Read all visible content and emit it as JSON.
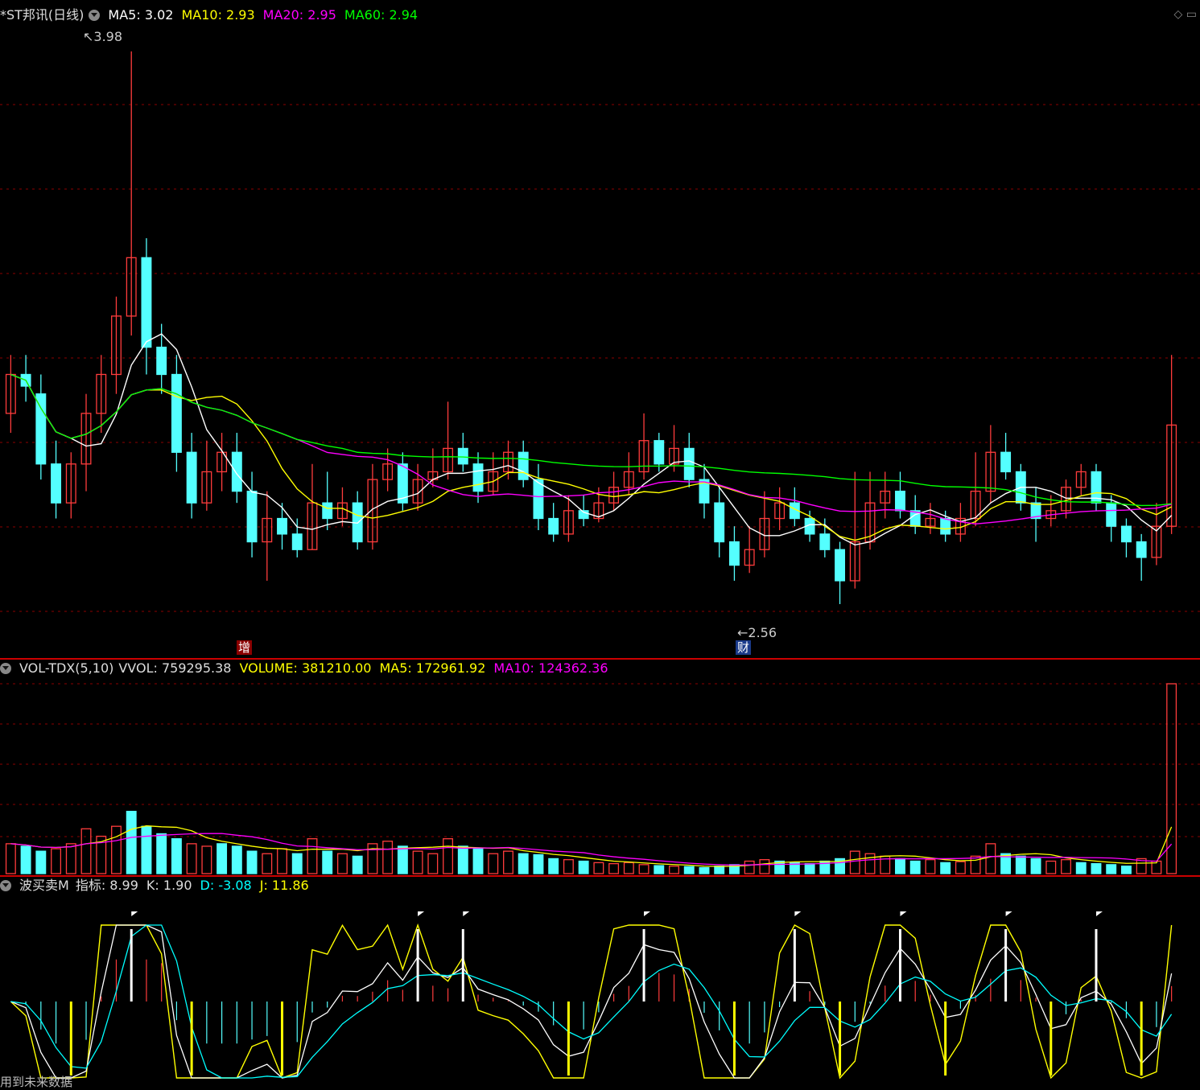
{
  "main": {
    "title": "*ST邦讯(日线)",
    "ma": [
      {
        "label": "MA5: 3.02",
        "color": "#ffffff"
      },
      {
        "label": "MA10: 2.93",
        "color": "#ffff00"
      },
      {
        "label": "MA20: 2.95",
        "color": "#ff00ff"
      },
      {
        "label": "MA60: 2.94",
        "color": "#00ff00"
      }
    ],
    "high_label": "3.98",
    "low_label": "2.56",
    "tag_zeng": "增",
    "tag_cai": "财"
  },
  "volume": {
    "name": "VOL-TDX(5,10)",
    "fields": [
      {
        "label": "VVOL: 759295.38",
        "color": "#dddddd"
      },
      {
        "label": "VOLUME: 381210.00",
        "color": "#ffff00"
      },
      {
        "label": "MA5: 172961.92",
        "color": "#ffff00"
      },
      {
        "label": "MA10: 124362.36",
        "color": "#ff00ff"
      }
    ]
  },
  "indicator": {
    "name": "波买卖M",
    "fields": [
      {
        "label": "指标: 8.99",
        "color": "#dddddd"
      },
      {
        "label": "K: 1.90",
        "color": "#dddddd"
      },
      {
        "label": "D: -3.08",
        "color": "#00ffff"
      },
      {
        "label": "J: 11.86",
        "color": "#ffff00"
      }
    ],
    "footer": "用到未来数据"
  },
  "colors": {
    "up": "#ff3c3c",
    "down": "#54ffff",
    "grid": "#8b0000",
    "ma5": "#ffffff",
    "ma10": "#ffff00",
    "ma20": "#ff00ff",
    "ma60": "#00ff00"
  },
  "chart_data": {
    "type": "candlestick",
    "price_range": [
      2.56,
      3.98
    ],
    "candles": [
      {
        "o": 3.05,
        "c": 3.15,
        "h": 3.2,
        "l": 3.0
      },
      {
        "o": 3.15,
        "c": 3.12,
        "h": 3.2,
        "l": 3.08
      },
      {
        "o": 3.1,
        "c": 2.92,
        "h": 3.15,
        "l": 2.88
      },
      {
        "o": 2.92,
        "c": 2.82,
        "h": 2.98,
        "l": 2.78
      },
      {
        "o": 2.82,
        "c": 2.92,
        "h": 2.95,
        "l": 2.78
      },
      {
        "o": 2.92,
        "c": 3.05,
        "h": 3.1,
        "l": 2.85
      },
      {
        "o": 3.05,
        "c": 3.15,
        "h": 3.2,
        "l": 3.0
      },
      {
        "o": 3.15,
        "c": 3.3,
        "h": 3.35,
        "l": 3.1
      },
      {
        "o": 3.3,
        "c": 3.45,
        "h": 3.98,
        "l": 3.25
      },
      {
        "o": 3.45,
        "c": 3.22,
        "h": 3.5,
        "l": 3.15
      },
      {
        "o": 3.22,
        "c": 3.15,
        "h": 3.28,
        "l": 3.1
      },
      {
        "o": 3.15,
        "c": 2.95,
        "h": 3.2,
        "l": 2.9
      },
      {
        "o": 2.95,
        "c": 2.82,
        "h": 3.0,
        "l": 2.78
      },
      {
        "o": 2.82,
        "c": 2.9,
        "h": 2.98,
        "l": 2.8
      },
      {
        "o": 2.9,
        "c": 2.95,
        "h": 3.0,
        "l": 2.85
      },
      {
        "o": 2.95,
        "c": 2.85,
        "h": 3.0,
        "l": 2.82
      },
      {
        "o": 2.85,
        "c": 2.72,
        "h": 2.9,
        "l": 2.68
      },
      {
        "o": 2.72,
        "c": 2.78,
        "h": 2.85,
        "l": 2.62
      },
      {
        "o": 2.78,
        "c": 2.74,
        "h": 2.82,
        "l": 2.7
      },
      {
        "o": 2.74,
        "c": 2.7,
        "h": 2.78,
        "l": 2.68
      },
      {
        "o": 2.7,
        "c": 2.82,
        "h": 2.92,
        "l": 2.7
      },
      {
        "o": 2.82,
        "c": 2.78,
        "h": 2.9,
        "l": 2.75
      },
      {
        "o": 2.78,
        "c": 2.82,
        "h": 2.86,
        "l": 2.76
      },
      {
        "o": 2.82,
        "c": 2.72,
        "h": 2.85,
        "l": 2.7
      },
      {
        "o": 2.72,
        "c": 2.88,
        "h": 2.92,
        "l": 2.7
      },
      {
        "o": 2.88,
        "c": 2.92,
        "h": 2.96,
        "l": 2.85
      },
      {
        "o": 2.92,
        "c": 2.82,
        "h": 2.95,
        "l": 2.8
      },
      {
        "o": 2.82,
        "c": 2.88,
        "h": 2.92,
        "l": 2.8
      },
      {
        "o": 2.88,
        "c": 2.9,
        "h": 2.96,
        "l": 2.86
      },
      {
        "o": 2.9,
        "c": 2.96,
        "h": 3.08,
        "l": 2.88
      },
      {
        "o": 2.96,
        "c": 2.92,
        "h": 3.0,
        "l": 2.9
      },
      {
        "o": 2.92,
        "c": 2.85,
        "h": 2.95,
        "l": 2.82
      },
      {
        "o": 2.85,
        "c": 2.9,
        "h": 2.95,
        "l": 2.84
      },
      {
        "o": 2.9,
        "c": 2.95,
        "h": 2.98,
        "l": 2.88
      },
      {
        "o": 2.95,
        "c": 2.88,
        "h": 2.98,
        "l": 2.86
      },
      {
        "o": 2.88,
        "c": 2.78,
        "h": 2.92,
        "l": 2.75
      },
      {
        "o": 2.78,
        "c": 2.74,
        "h": 2.82,
        "l": 2.72
      },
      {
        "o": 2.74,
        "c": 2.8,
        "h": 2.84,
        "l": 2.72
      },
      {
        "o": 2.8,
        "c": 2.78,
        "h": 2.84,
        "l": 2.76
      },
      {
        "o": 2.78,
        "c": 2.82,
        "h": 2.86,
        "l": 2.77
      },
      {
        "o": 2.82,
        "c": 2.86,
        "h": 2.9,
        "l": 2.8
      },
      {
        "o": 2.86,
        "c": 2.9,
        "h": 2.95,
        "l": 2.84
      },
      {
        "o": 2.9,
        "c": 2.98,
        "h": 3.05,
        "l": 2.88
      },
      {
        "o": 2.98,
        "c": 2.92,
        "h": 3.0,
        "l": 2.9
      },
      {
        "o": 2.92,
        "c": 2.96,
        "h": 3.02,
        "l": 2.9
      },
      {
        "o": 2.96,
        "c": 2.88,
        "h": 3.0,
        "l": 2.86
      },
      {
        "o": 2.88,
        "c": 2.82,
        "h": 2.92,
        "l": 2.78
      },
      {
        "o": 2.82,
        "c": 2.72,
        "h": 2.86,
        "l": 2.68
      },
      {
        "o": 2.72,
        "c": 2.66,
        "h": 2.76,
        "l": 2.62
      },
      {
        "o": 2.66,
        "c": 2.7,
        "h": 2.76,
        "l": 2.64
      },
      {
        "o": 2.7,
        "c": 2.78,
        "h": 2.85,
        "l": 2.68
      },
      {
        "o": 2.78,
        "c": 2.82,
        "h": 2.86,
        "l": 2.75
      },
      {
        "o": 2.82,
        "c": 2.78,
        "h": 2.86,
        "l": 2.76
      },
      {
        "o": 2.78,
        "c": 2.74,
        "h": 2.8,
        "l": 2.72
      },
      {
        "o": 2.74,
        "c": 2.7,
        "h": 2.78,
        "l": 2.68
      },
      {
        "o": 2.7,
        "c": 2.62,
        "h": 2.72,
        "l": 2.56
      },
      {
        "o": 2.62,
        "c": 2.72,
        "h": 2.9,
        "l": 2.6
      },
      {
        "o": 2.72,
        "c": 2.82,
        "h": 2.9,
        "l": 2.7
      },
      {
        "o": 2.82,
        "c": 2.85,
        "h": 2.9,
        "l": 2.78
      },
      {
        "o": 2.85,
        "c": 2.8,
        "h": 2.9,
        "l": 2.78
      },
      {
        "o": 2.8,
        "c": 2.76,
        "h": 2.84,
        "l": 2.74
      },
      {
        "o": 2.76,
        "c": 2.78,
        "h": 2.82,
        "l": 2.74
      },
      {
        "o": 2.78,
        "c": 2.74,
        "h": 2.8,
        "l": 2.72
      },
      {
        "o": 2.74,
        "c": 2.78,
        "h": 2.82,
        "l": 2.72
      },
      {
        "o": 2.78,
        "c": 2.85,
        "h": 2.95,
        "l": 2.76
      },
      {
        "o": 2.85,
        "c": 2.95,
        "h": 3.02,
        "l": 2.82
      },
      {
        "o": 2.95,
        "c": 2.9,
        "h": 3.0,
        "l": 2.88
      },
      {
        "o": 2.9,
        "c": 2.82,
        "h": 2.92,
        "l": 2.8
      },
      {
        "o": 2.82,
        "c": 2.78,
        "h": 2.86,
        "l": 2.72
      },
      {
        "o": 2.78,
        "c": 2.8,
        "h": 2.84,
        "l": 2.76
      },
      {
        "o": 2.8,
        "c": 2.86,
        "h": 2.88,
        "l": 2.78
      },
      {
        "o": 2.86,
        "c": 2.9,
        "h": 2.92,
        "l": 2.84
      },
      {
        "o": 2.9,
        "c": 2.82,
        "h": 2.92,
        "l": 2.8
      },
      {
        "o": 2.82,
        "c": 2.76,
        "h": 2.84,
        "l": 2.72
      },
      {
        "o": 2.76,
        "c": 2.72,
        "h": 2.78,
        "l": 2.68
      },
      {
        "o": 2.72,
        "c": 2.68,
        "h": 2.74,
        "l": 2.62
      },
      {
        "o": 2.68,
        "c": 2.76,
        "h": 2.82,
        "l": 2.66
      },
      {
        "o": 2.76,
        "c": 3.02,
        "h": 3.2,
        "l": 2.74
      }
    ],
    "volume_range": [
      0,
      381210
    ],
    "volumes": [
      {
        "v": 60000,
        "up": true
      },
      {
        "v": 55000,
        "up": false
      },
      {
        "v": 45000,
        "up": false
      },
      {
        "v": 50000,
        "up": true
      },
      {
        "v": 60000,
        "up": true
      },
      {
        "v": 90000,
        "up": true
      },
      {
        "v": 75000,
        "up": true
      },
      {
        "v": 95000,
        "up": true
      },
      {
        "v": 125000,
        "up": false
      },
      {
        "v": 95000,
        "up": false
      },
      {
        "v": 80000,
        "up": false
      },
      {
        "v": 70000,
        "up": false
      },
      {
        "v": 60000,
        "up": true
      },
      {
        "v": 55000,
        "up": true
      },
      {
        "v": 60000,
        "up": false
      },
      {
        "v": 55000,
        "up": false
      },
      {
        "v": 45000,
        "up": false
      },
      {
        "v": 40000,
        "up": true
      },
      {
        "v": 50000,
        "up": true
      },
      {
        "v": 40000,
        "up": false
      },
      {
        "v": 70000,
        "up": true
      },
      {
        "v": 45000,
        "up": false
      },
      {
        "v": 40000,
        "up": true
      },
      {
        "v": 35000,
        "up": false
      },
      {
        "v": 60000,
        "up": true
      },
      {
        "v": 65000,
        "up": true
      },
      {
        "v": 55000,
        "up": false
      },
      {
        "v": 45000,
        "up": true
      },
      {
        "v": 40000,
        "up": true
      },
      {
        "v": 70000,
        "up": true
      },
      {
        "v": 55000,
        "up": false
      },
      {
        "v": 50000,
        "up": false
      },
      {
        "v": 40000,
        "up": true
      },
      {
        "v": 45000,
        "up": true
      },
      {
        "v": 40000,
        "up": false
      },
      {
        "v": 38000,
        "up": false
      },
      {
        "v": 30000,
        "up": false
      },
      {
        "v": 28000,
        "up": true
      },
      {
        "v": 25000,
        "up": false
      },
      {
        "v": 22000,
        "up": true
      },
      {
        "v": 20000,
        "up": true
      },
      {
        "v": 22000,
        "up": true
      },
      {
        "v": 18000,
        "up": true
      },
      {
        "v": 16000,
        "up": false
      },
      {
        "v": 15000,
        "up": true
      },
      {
        "v": 14000,
        "up": false
      },
      {
        "v": 12000,
        "up": false
      },
      {
        "v": 15000,
        "up": false
      },
      {
        "v": 18000,
        "up": false
      },
      {
        "v": 25000,
        "up": true
      },
      {
        "v": 28000,
        "up": true
      },
      {
        "v": 25000,
        "up": false
      },
      {
        "v": 22000,
        "up": false
      },
      {
        "v": 20000,
        "up": false
      },
      {
        "v": 25000,
        "up": false
      },
      {
        "v": 30000,
        "up": false
      },
      {
        "v": 45000,
        "up": true
      },
      {
        "v": 40000,
        "up": true
      },
      {
        "v": 35000,
        "up": true
      },
      {
        "v": 30000,
        "up": false
      },
      {
        "v": 25000,
        "up": false
      },
      {
        "v": 28000,
        "up": true
      },
      {
        "v": 22000,
        "up": false
      },
      {
        "v": 24000,
        "up": true
      },
      {
        "v": 35000,
        "up": true
      },
      {
        "v": 60000,
        "up": true
      },
      {
        "v": 40000,
        "up": false
      },
      {
        "v": 35000,
        "up": false
      },
      {
        "v": 30000,
        "up": false
      },
      {
        "v": 25000,
        "up": true
      },
      {
        "v": 28000,
        "up": true
      },
      {
        "v": 22000,
        "up": false
      },
      {
        "v": 20000,
        "up": false
      },
      {
        "v": 18000,
        "up": false
      },
      {
        "v": 15000,
        "up": false
      },
      {
        "v": 30000,
        "up": true
      },
      {
        "v": 25000,
        "up": true
      },
      {
        "v": 381210,
        "up": true
      }
    ],
    "indicator_range": [
      -100,
      100
    ]
  }
}
